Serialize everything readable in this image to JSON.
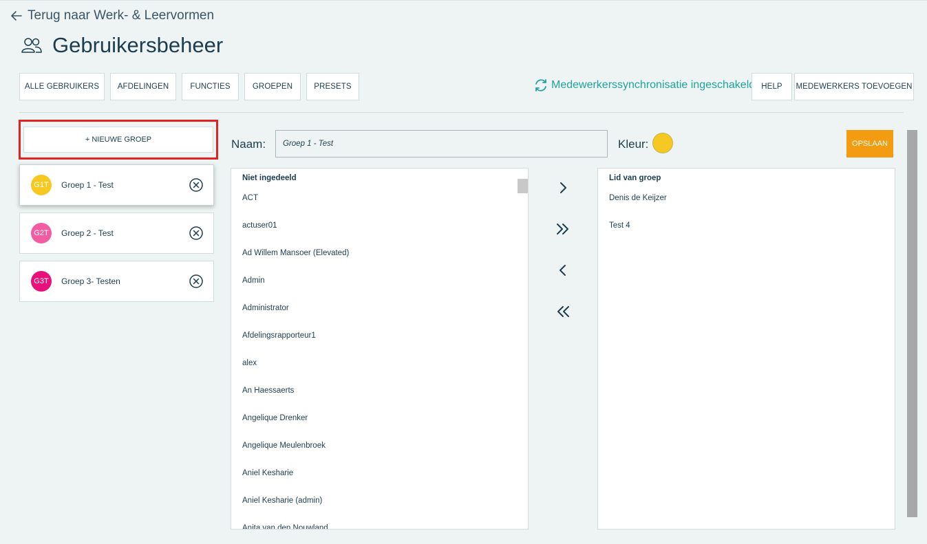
{
  "header": {
    "back_label": "Terug naar Werk- & Leervormen",
    "title": "Gebruikersbeheer"
  },
  "nav": {
    "alle_gebruikers": "ALLE GEBRUIKERS",
    "afdelingen": "AFDELINGEN",
    "functies": "FUNCTIES",
    "groepen": "GROEPEN",
    "presets": "PRESETS",
    "sync_status": "Medewerkerssynchronisatie ingeschakeld",
    "help": "HELP",
    "medewerkers_toevoegen": "MEDEWERKERS TOEVOEGEN"
  },
  "sidebar": {
    "new_group_label": "+ NIEUWE GROEP",
    "groups": [
      {
        "initials": "G1T",
        "name": "Groep 1 - Test",
        "color": "#f6c922",
        "active": true
      },
      {
        "initials": "G2T",
        "name": "Groep 2 - Test",
        "color": "#f25ca2",
        "active": false
      },
      {
        "initials": "G3T",
        "name": "Groep 3- Testen",
        "color": "#e8107a",
        "active": false
      }
    ]
  },
  "editor": {
    "name_label": "Naam:",
    "name_value": "Groep 1 - Test",
    "color_label": "Kleur:",
    "color_value": "#f6c922",
    "save_label": "OPSLAAN"
  },
  "unassigned": {
    "header": "Niet ingedeeld",
    "items": [
      "ACT",
      "actuser01",
      "Ad Willem Mansoer (Elevated)",
      "Admin",
      "Administrator",
      "Afdelingsrapporteur1",
      "alex",
      "An Haessaerts",
      "Angelique Drenker",
      "Angelique Meulenbroek",
      "Aniel Kesharie",
      "Aniel Kesharie (admin)",
      "Anita van den Nouwland"
    ]
  },
  "members": {
    "header": "Lid van groep",
    "items": [
      "Denis de Keijzer",
      "Test 4"
    ]
  },
  "transfer_icons": [
    "chevron-right-icon",
    "double-chevron-right-icon",
    "chevron-left-icon",
    "double-chevron-left-icon"
  ],
  "colors": {
    "accent": "#1fa39a",
    "save": "#f39c12",
    "highlight": "#e02424"
  }
}
